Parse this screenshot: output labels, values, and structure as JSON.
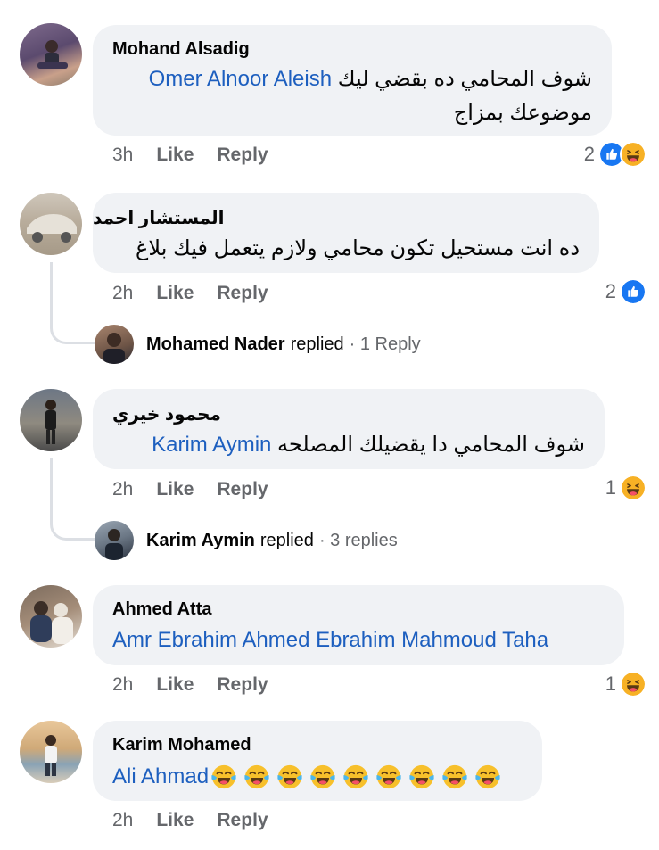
{
  "colors": {
    "bubble": "#f0f2f5",
    "mention": "#1d5fbf",
    "meta": "#65676b",
    "like_blue": "#1877f2",
    "haha_yellow": "#f7b125"
  },
  "actions": {
    "like": "Like",
    "reply": "Reply"
  },
  "comments": [
    {
      "author": "Mohand Alsadig",
      "mention": "Omer Alnoor Aleish",
      "text_line1": "شوف المحامي ده بقضي ليك",
      "text_line2": "موضوعك بمزاج",
      "time": "3h",
      "reaction_count": "2",
      "reaction_icons": [
        "like-icon",
        "haha-icon"
      ]
    },
    {
      "author": "المستشار احمد",
      "text_line1": "ده انت مستحيل تكون محامي ولازم يتعمل فيك بلاغ",
      "time": "2h",
      "reaction_count": "2",
      "reaction_icons": [
        "like-icon"
      ],
      "replies": {
        "name": "Mohamed Nader",
        "verb": "replied",
        "count": "· 1 Reply"
      }
    },
    {
      "author": "محمود خيري",
      "mention": "Karim Aymin",
      "text_line1": "شوف المحامي دا يقضيلك المصلحه",
      "time": "2h",
      "reaction_count": "1",
      "reaction_icons": [
        "haha-icon"
      ],
      "replies": {
        "name": "Karim Aymin",
        "verb": "replied",
        "count": "· 3 replies"
      }
    },
    {
      "author": "Ahmed Atta",
      "mention": "Amr Ebrahim Ahmed Ebrahim Mahmoud Taha",
      "time": "2h",
      "reaction_count": "1",
      "reaction_icons": [
        "haha-icon"
      ]
    },
    {
      "author": "Karim Mohamed",
      "mention": "Ali Ahmad",
      "emoji_count_shown": 9,
      "emoji": "face-with-tears-of-joy-icon",
      "time": "2h"
    }
  ]
}
